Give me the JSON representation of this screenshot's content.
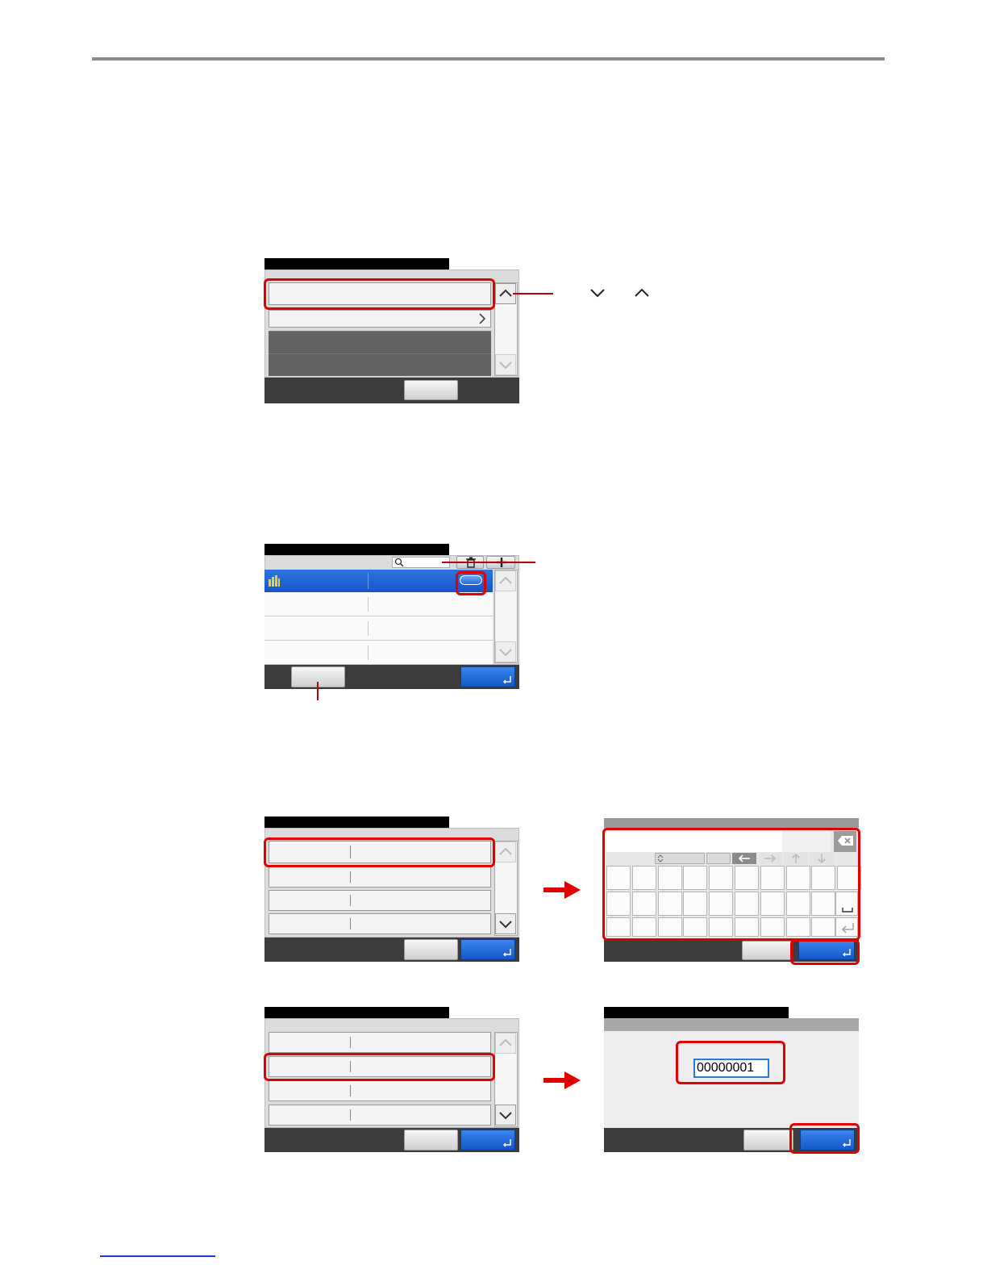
{
  "page": {
    "footer_link": ""
  },
  "legend_icons": {
    "down": "chevron-down",
    "up": "chevron-up"
  },
  "screens": {
    "s5": {
      "entry_value": "00000001"
    }
  },
  "colors": {
    "highlight": "#e00000",
    "accent_blue": "#1356c8",
    "rule": "#8a8a8a"
  }
}
